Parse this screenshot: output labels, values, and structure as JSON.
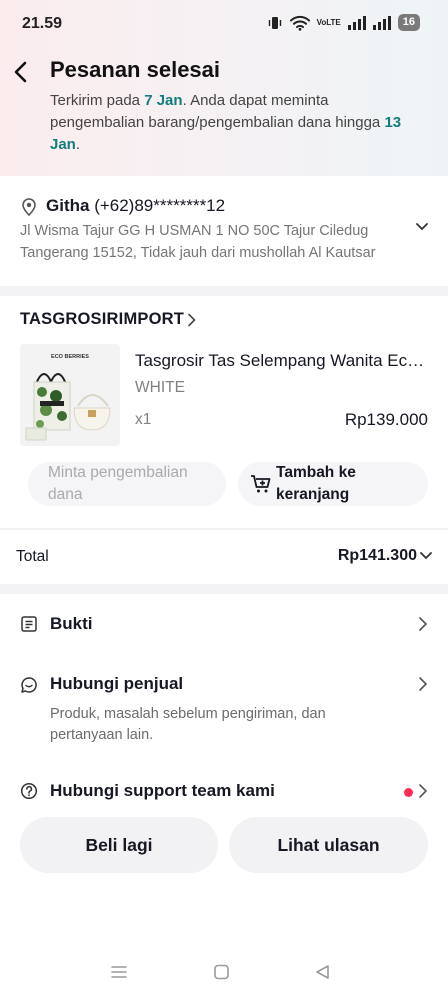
{
  "status_bar": {
    "time": "21.59",
    "volte_top": "Vo",
    "volte_bottom": "LTE",
    "battery": "16"
  },
  "header": {
    "title": "Pesanan selesai",
    "subtitle_prefix": "Terkirim pada ",
    "delivered_date": "7 Jan",
    "subtitle_middle": ". Anda dapat meminta pengembalian barang/pengembalian dana hingga ",
    "deadline_date": "13 Jan",
    "subtitle_suffix": "."
  },
  "address": {
    "name": "Githa",
    "phone": "(+62)89********12",
    "line1": "Jl Wisma Tajur GG H USMAN 1 NO 50C Tajur Ciledug",
    "line2": "Tangerang 15152, Tidak jauh dari mushollah Al Kautsar"
  },
  "shop": {
    "name": "TASGROSIRIMPORT"
  },
  "product": {
    "name": "Tasgrosir Tas Selempang Wanita Eco Berries",
    "variant": "WHITE",
    "quantity": "x1",
    "price": "Rp139.000",
    "image_brand_text": "ECO BERRIES"
  },
  "actions": {
    "return_label": "Minta pengembalian dana",
    "add_cart_label": "Tambah ke keranjang"
  },
  "total": {
    "label": "Total",
    "value": "Rp141.300"
  },
  "menu": [
    {
      "label": "Bukti"
    },
    {
      "label": "Hubungi penjual",
      "description": "Produk, masalah sebelum pengiriman, dan pertanyaan lain."
    },
    {
      "label": "Hubungi support team kami"
    }
  ],
  "buttons": {
    "buy_again": "Beli lagi",
    "see_review": "Lihat ulasan"
  },
  "colors": {
    "accent_teal": "#127d7d",
    "notification_red": "#fe2c55",
    "text_primary": "#161823"
  }
}
